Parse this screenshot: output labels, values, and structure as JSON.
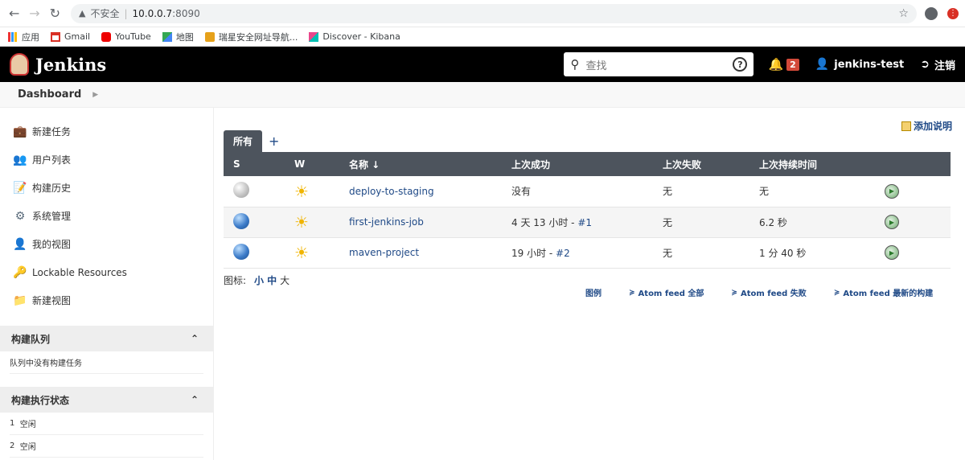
{
  "browser": {
    "insecure_label": "不安全",
    "url_host": "10.0.0.7",
    "url_port": ":8090",
    "bookmarks": [
      {
        "label": "应用",
        "icon": "apps-grid-icon"
      },
      {
        "label": "Gmail",
        "icon": "gmail-icon"
      },
      {
        "label": "YouTube",
        "icon": "youtube-icon"
      },
      {
        "label": "地图",
        "icon": "maps-icon"
      },
      {
        "label": "瑞星安全网址导航...",
        "icon": "rising-icon"
      },
      {
        "label": "Discover - Kibana",
        "icon": "kibana-icon"
      }
    ]
  },
  "header": {
    "title": "Jenkins",
    "search_placeholder": "查找",
    "notification_count": "2",
    "username": "jenkins-test",
    "logout_label": "注销"
  },
  "breadcrumb": {
    "root": "Dashboard"
  },
  "sidebar": {
    "tasks": [
      {
        "label": "新建任务",
        "icon": "new-item-icon"
      },
      {
        "label": "用户列表",
        "icon": "people-icon"
      },
      {
        "label": "构建历史",
        "icon": "notepad-icon"
      },
      {
        "label": "系统管理",
        "icon": "gear-icon"
      },
      {
        "label": "我的视图",
        "icon": "user-icon"
      },
      {
        "label": "Lockable Resources",
        "icon": "lock-resources-icon"
      },
      {
        "label": "新建视图",
        "icon": "folder-icon"
      }
    ],
    "build_queue": {
      "title": "构建队列",
      "empty_text": "队列中没有构建任务"
    },
    "executors": {
      "title": "构建执行状态",
      "items": [
        {
          "num": "1",
          "status": "空闲"
        },
        {
          "num": "2",
          "status": "空闲"
        }
      ]
    }
  },
  "main": {
    "add_description": "添加说明",
    "tab_all": "所有",
    "tab_add": "+",
    "columns": {
      "s": "S",
      "w": "W",
      "name": "名称 ↓",
      "last_success": "上次成功",
      "last_failure": "上次失败",
      "last_duration": "上次持续时间"
    },
    "jobs": [
      {
        "status": "grey",
        "weather": "sunny",
        "name": "deploy-to-staging",
        "last_success_text": "没有",
        "last_success_build": "",
        "last_failure": "无",
        "last_duration": "无"
      },
      {
        "status": "blue",
        "weather": "sunny",
        "name": "first-jenkins-job",
        "last_success_text": "4 天 13 小时 - ",
        "last_success_build": "#1",
        "last_failure": "无",
        "last_duration": "6.2 秒"
      },
      {
        "status": "blue",
        "weather": "sunny",
        "name": "maven-project",
        "last_success_text": "19 小时 - ",
        "last_success_build": "#2",
        "last_failure": "无",
        "last_duration": "1 分 40 秒"
      }
    ],
    "icon_legend": {
      "label": "图标:",
      "small": "小",
      "medium": "中",
      "large": "大"
    },
    "feeds": {
      "legend": "图例",
      "all": "Atom feed 全部",
      "failures": "Atom feed 失败",
      "latest": "Atom feed 最新的构建"
    }
  }
}
